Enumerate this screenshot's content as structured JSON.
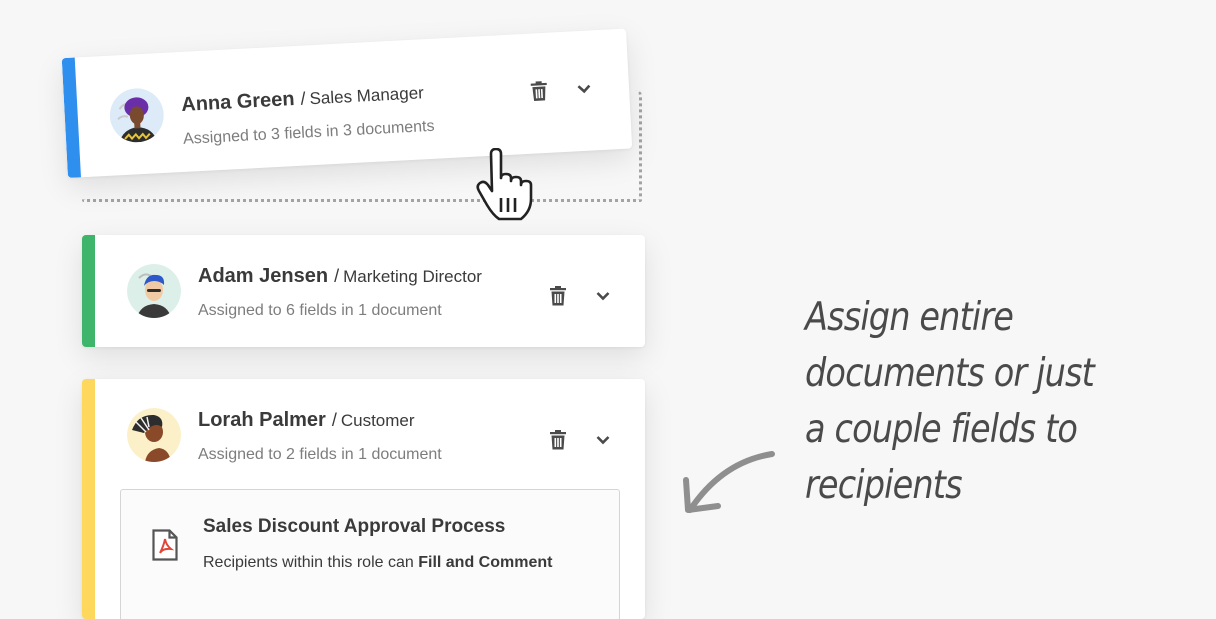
{
  "recipients": [
    {
      "name": "Anna Green",
      "role": "Sales Manager",
      "assigned": "Assigned to 3 fields in 3 documents",
      "color": "#2f8fef",
      "avatar_bg": "#dcebf7"
    },
    {
      "name": "Adam Jensen",
      "role": "Marketing Director",
      "assigned": "Assigned to 6 fields in 1 document",
      "color": "#3fb56c",
      "avatar_bg": "#dcefe8"
    },
    {
      "name": "Lorah Palmer",
      "role": "Customer",
      "assigned": "Assigned to 2 fields in 1 document",
      "color": "#fdd85d",
      "avatar_bg": "#fbf0c8"
    }
  ],
  "slash": "/",
  "document": {
    "title": "Sales Discount Approval Process",
    "permission_prefix": "Recipients within this role can",
    "permission": "Fill and Comment",
    "icon": "pdf-icon"
  },
  "icons": {
    "delete": "trash-icon",
    "expand": "chevron-down-icon",
    "pointer": "hand-cursor-icon",
    "arrow": "hand-drawn-arrow-icon"
  },
  "annotation": [
    "Assign entire",
    "documents or just",
    "a couple fields to",
    "recipients"
  ]
}
